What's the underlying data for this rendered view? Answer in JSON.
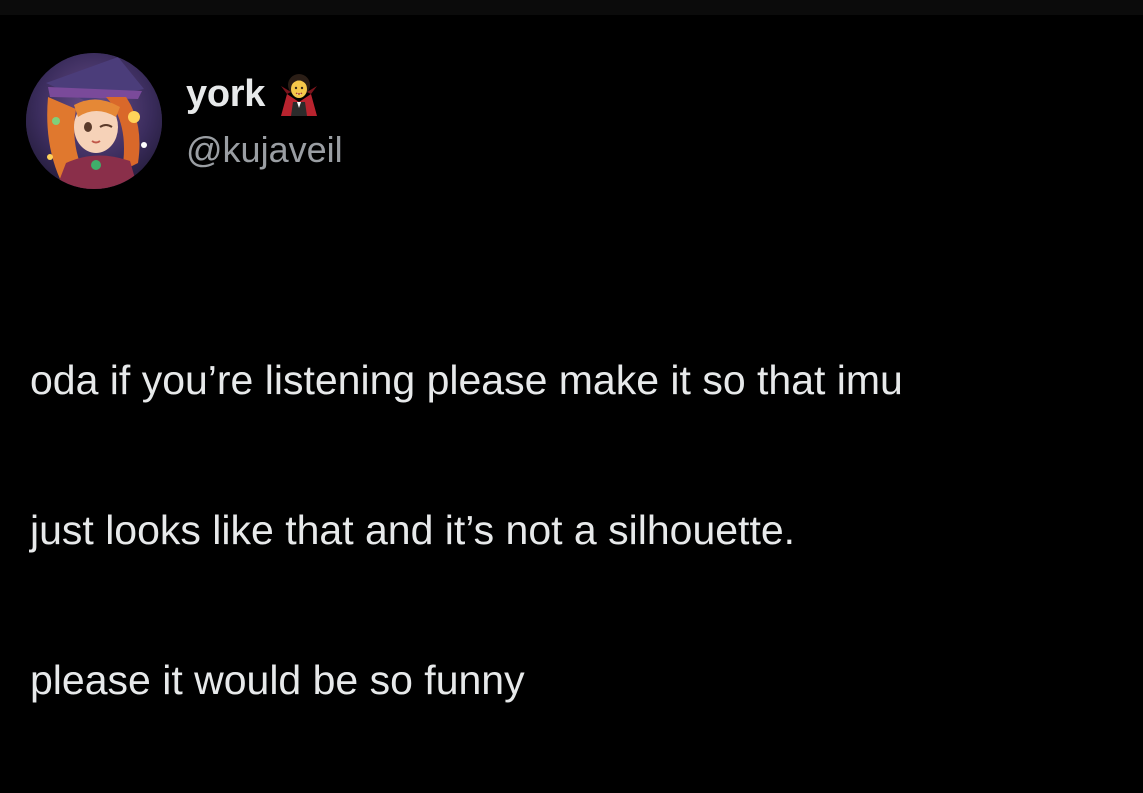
{
  "tweet": {
    "author": {
      "display_name": "york",
      "name_emoji": "vampire-emoji",
      "handle": "@kujaveil",
      "avatar": "anime-character-avatar"
    },
    "text_lines": [
      "oda if you’re listening please make it so that imu",
      "just looks like that and it’s not a silhouette.",
      "please it would be so funny"
    ]
  },
  "colors": {
    "background": "#000000",
    "text": "#e7e9ea",
    "secondary_text": "#9a9ea3"
  }
}
